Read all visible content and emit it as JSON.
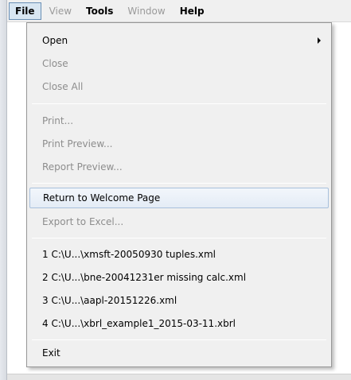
{
  "menubar": {
    "items": [
      {
        "label": "File",
        "state": "active"
      },
      {
        "label": "View",
        "state": "disabled"
      },
      {
        "label": "Tools",
        "state": "enabled"
      },
      {
        "label": "Window",
        "state": "disabled"
      },
      {
        "label": "Help",
        "state": "enabled"
      }
    ]
  },
  "file_menu": {
    "open": "Open",
    "close": "Close",
    "close_all": "Close All",
    "print": "Print...",
    "print_preview": "Print Preview...",
    "report_preview": "Report Preview...",
    "return_welcome": "Return to Welcome Page",
    "export_excel": "Export to Excel...",
    "recent": [
      "1 C:\\U...\\xmsft-20050930 tuples.xml",
      "2 C:\\U...\\bne-20041231er missing calc.xml",
      "3 C:\\U...\\aapl-20151226.xml",
      "4 C:\\U...\\xbrl_example1_2015-03-11.xbrl"
    ],
    "exit": "Exit"
  },
  "colors": {
    "menu_bg": "#f0f0f0",
    "highlight_border": "#a8c0dc",
    "disabled_text": "#8d8d8d"
  }
}
